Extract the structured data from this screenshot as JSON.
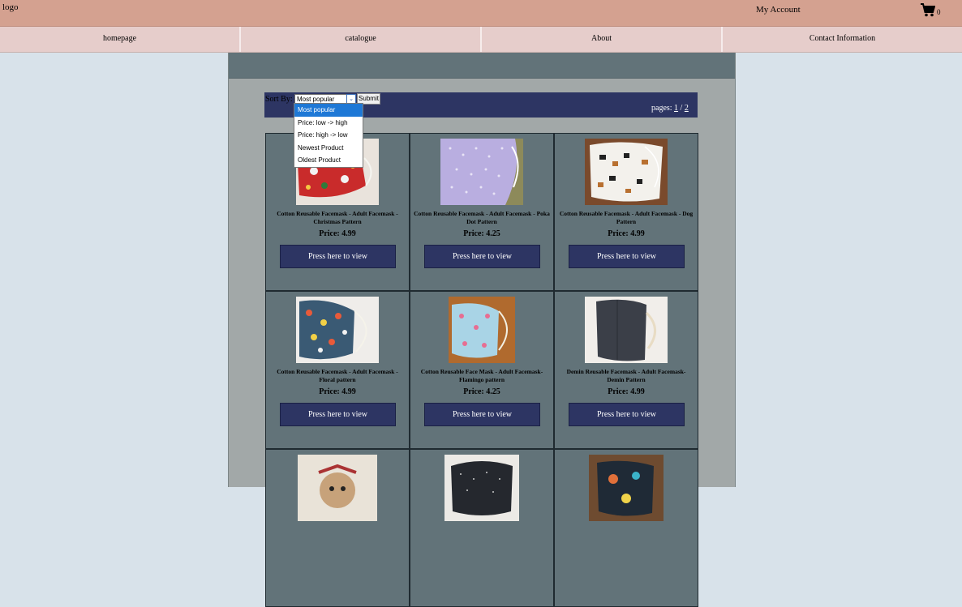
{
  "header": {
    "logo": "logo",
    "account": "My Account",
    "cart_count": "0"
  },
  "nav": {
    "items": [
      "homepage",
      "catalogue",
      "About",
      "Contact Information"
    ]
  },
  "sort": {
    "label": "Sort By:",
    "selected": "Most popular",
    "submit": "Submit",
    "options": [
      "Most popular",
      "Price: low -> high",
      "Price: high -> low",
      "Newest Product",
      "Oldest Product"
    ]
  },
  "pagination": {
    "label": "pages:",
    "current": "1",
    "separator": "/",
    "total": "2"
  },
  "products": [
    {
      "name": "Cotton Reusable Facemask - Adult Facemask - Christmas Pattern",
      "price": "Price: 4.99",
      "button": "Press here to view"
    },
    {
      "name": "Cotton Reusable Facemask - Adult Facemask - Poka Dot Pattern",
      "price": "Price: 4.25",
      "button": "Press here to view"
    },
    {
      "name": "Cotton Reusable Facemask - Adult Facemask - Dog Pattern",
      "price": "Price: 4.99",
      "button": "Press here to view"
    },
    {
      "name": "Cotton Reusable Facemask - Adult Facemask - Floral pattern",
      "price": "Price: 4.99",
      "button": "Press here to view"
    },
    {
      "name": "Cotton Reusable Face Mask - Adult Facemask- Flamingo pattern",
      "price": "Price: 4.25",
      "button": "Press here to view"
    },
    {
      "name": "Demin Reusable Facemask - Adult Facemask- Demin Pattern",
      "price": "Price: 4.99",
      "button": "Press here to view"
    }
  ],
  "colors": {
    "topbar": "#d4a190",
    "nav": "#e6cdcb",
    "panel": "#a2a8a8",
    "card": "#627379",
    "button": "#2d3563",
    "selected_option": "#1e78d6"
  }
}
